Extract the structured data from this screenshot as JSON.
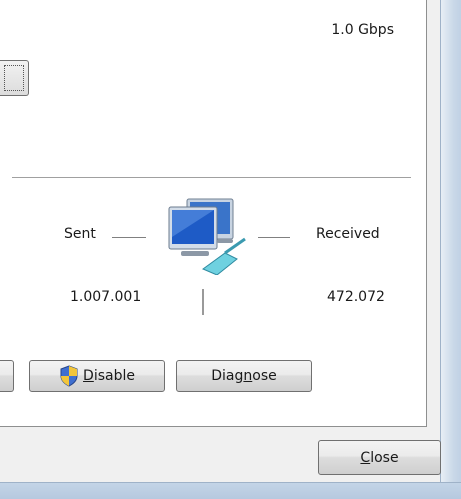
{
  "connection": {
    "speed": "1.0 Gbps"
  },
  "activity": {
    "sent_label": "Sent",
    "received_label": "Received",
    "sent_value": "1.007.001",
    "received_value": "472.072"
  },
  "buttons": {
    "disable": {
      "accel": "D",
      "rest": "isable"
    },
    "diagnose": {
      "pre": "Diag",
      "accel": "n",
      "rest": "ose"
    },
    "close": {
      "accel": "C",
      "rest": "lose"
    }
  },
  "icons": {
    "network": "network-computers-icon",
    "shield": "uac-shield-icon"
  }
}
